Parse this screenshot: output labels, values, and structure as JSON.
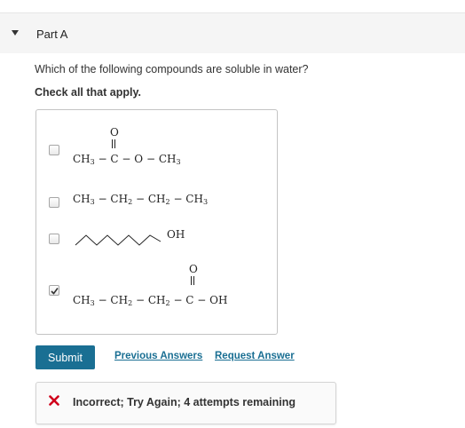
{
  "part": {
    "title": "Part A"
  },
  "question": {
    "prompt": "Which of the following compounds are soluble in water?",
    "instruction": "Check all that apply."
  },
  "options": [
    {
      "checked": false,
      "formula": {
        "carbonyl_o": "O",
        "left": "CH",
        "left_sub": "3",
        "mid": " − C − O − CH",
        "end_sub": "3"
      }
    },
    {
      "checked": false,
      "formula": {
        "p1": "CH",
        "s1": "3",
        "p2": " − CH",
        "s2": "2",
        "p3": " − CH",
        "s3": "2",
        "p4": " − CH",
        "s4": "3"
      }
    },
    {
      "checked": false,
      "formula": {
        "group": "OH",
        "skeleton_icon": "zigzag-chain"
      }
    },
    {
      "checked": true,
      "formula": {
        "carbonyl_o": "O",
        "p1": "CH",
        "s1": "3",
        "p2": " − CH",
        "s2": "2",
        "p3": " − CH",
        "s3": "2",
        "p4": " − C − OH"
      }
    }
  ],
  "actions": {
    "submit_label": "Submit",
    "previous_answers_label": "Previous Answers",
    "request_answer_label": "Request Answer"
  },
  "feedback": {
    "icon": "x-icon",
    "text": "Incorrect; Try Again; 4 attempts remaining",
    "icon_color": "#d0021b"
  },
  "colors": {
    "accent": "#1a6f93",
    "header_bg": "#f5f5f5"
  }
}
